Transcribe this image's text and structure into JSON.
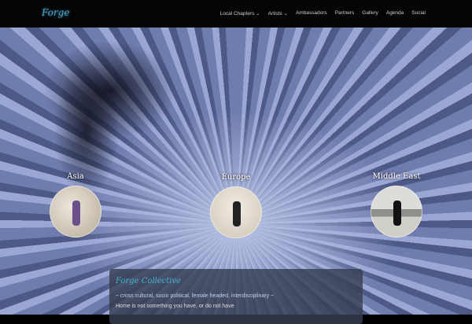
{
  "header": {
    "logo": "Forge",
    "menu": [
      "Local Chapters ⌄",
      "Artists ⌄",
      "Ambassadors",
      "Partners",
      "Gallery",
      "Agenda",
      "Social"
    ]
  },
  "regions": [
    {
      "label": "Asia"
    },
    {
      "label": "Europe"
    },
    {
      "label": "Middle East"
    }
  ],
  "card": {
    "title": "Forge Collective",
    "tagline": "~ cross cultural, socio political, female headed, interdisciplinary ~",
    "text": "Home is not something you have, or do not have"
  }
}
